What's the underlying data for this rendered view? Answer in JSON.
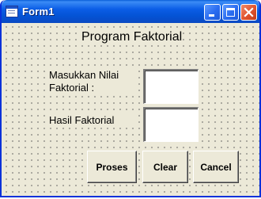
{
  "window": {
    "title": "Form1"
  },
  "form": {
    "heading": "Program Faktorial",
    "input_label": "Masukkan Nilai\nFaktorial :",
    "input_value": "",
    "result_label": "Hasil Faktorial",
    "result_value": ""
  },
  "buttons": {
    "proses": "Proses",
    "clear": "Clear",
    "cancel": "Cancel"
  }
}
